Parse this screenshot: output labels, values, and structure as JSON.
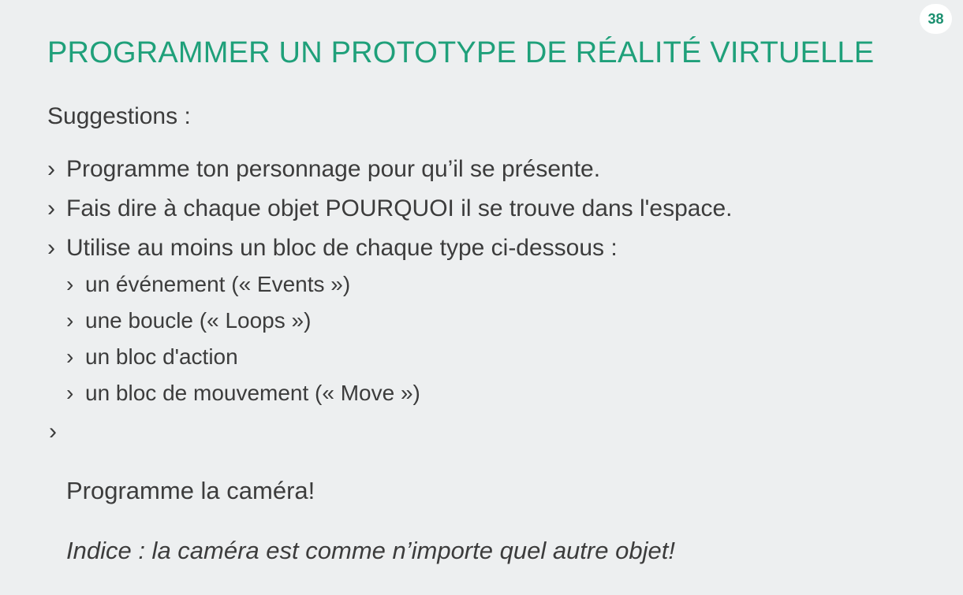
{
  "slide": {
    "page_number": "38",
    "title": "PROGRAMMER UN PROTOTYPE DE RÉALITÉ VIRTUELLE",
    "subtitle": "Suggestions :",
    "bullet_marker": "›",
    "bullets": [
      "Programme ton personnage pour qu’il se présente.",
      "Fais dire à chaque objet POURQUOI il se trouve dans l'espace.",
      "Utilise au moins un bloc de chaque type ci-dessous :"
    ],
    "sub_bullets": [
      "un événement (« Events »)",
      "une boucle (« Loops »)",
      "un bloc d'action",
      "un bloc de mouvement (« Move »)"
    ],
    "camera_text": "Programme la caméra!",
    "hint_text": "Indice : la caméra est comme n’importe quel autre objet!"
  },
  "colors": {
    "background": "#edeff0",
    "title": "#1fa07a",
    "badge_text": "#1a8f6f",
    "body_text": "#3c3c3c"
  }
}
